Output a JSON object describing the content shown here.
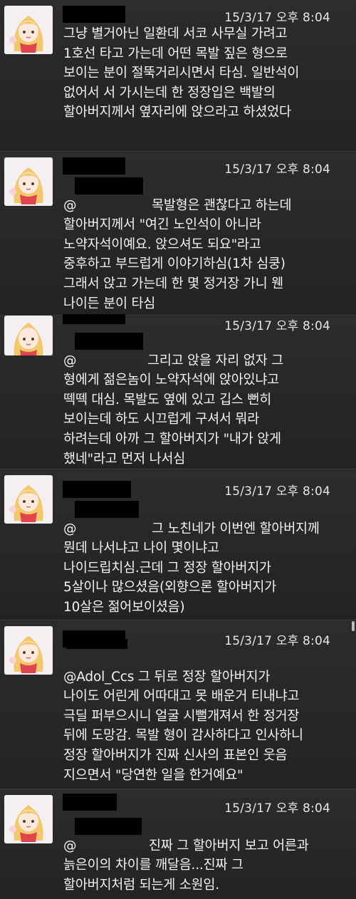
{
  "tweets": [
    {
      "handle": "",
      "time": "15/3/17 오후 8:04",
      "text": "그냥 별거아닌 일환데 서코 사무실 가려고\n1호선 타고 가는데 어떤 목발 짚은 형으로\n보이는 분이 절뚝거리시면서 타심. 일반석이\n없어서 서 가시는데 한 정장입은 백발의\n할아버지께서 옆자리에 앉으라고 하셨었다"
    },
    {
      "handle": "",
      "time": "15/3/17 오후 8:04",
      "mention": "@",
      "text": " 목발형은 괜찮다고 하는데\n할아버지께서 \"여긴 노인석이 아니라\n노약자석이예요. 앉으셔도 되요\"라고\n중후하고 부드럽게 이야기하심(1차 심쿵)\n그래서 앉고 가는데 한 몇 정거장 가니 웬\n나이든 분이 타심"
    },
    {
      "handle": "",
      "time": "15/3/17 오후 8:04",
      "mention": "@",
      "text": " 그리고 앉을 자리 없자 그\n형에게 젊은놈이 노약자석에 앉아있냐고\n떽떽 대심. 목발도 옆에 있고 깁스 뻔히\n보이는데 하도 시끄럽게 구셔서 뭐라\n하려는데 아까 그 할아버지가 \"내가 앉게\n했네\"라고 먼저 나서심"
    },
    {
      "handle": "",
      "time": "15/3/17 오후 8:04",
      "mention": "@",
      "text": " 그 노친네가 이번엔 할아버지께\n뭔데 나서냐고 나이 몇이냐고\n나이드립치심.근데 그 정장 할아버지가\n5살이나 많으셨음(외향으론 할아버지가\n10살은 젊어보이셨음)"
    },
    {
      "handle": "",
      "time": "15/3/17 오후 8:04",
      "mention": "@Adol_Ccs",
      "text": " 그 뒤로 정장 할아버지가\n나이도 어린게 어따대고 못 배운거 티내냐고\n극딜 퍼부으시니 얼굴 시뻘개져서 한 정거장\n뒤에 도망감. 목발 형이 감사하다고 인사하니\n정장 할아버지가 진짜 신사의 표본인 웃음\n지으면서 \"당연한 일을 한거예요\""
    },
    {
      "handle": "",
      "time": "15/3/17 오후 8:04",
      "mention": "@",
      "text": " 진짜 그 할아버지 보고 어른과\n늙은이의 차이를 깨달음...진짜 그\n할아버지처럼 되는게 소원임."
    }
  ],
  "colors": {
    "background": "#232323",
    "text": "#f2f2f2",
    "redaction": "#000000"
  }
}
